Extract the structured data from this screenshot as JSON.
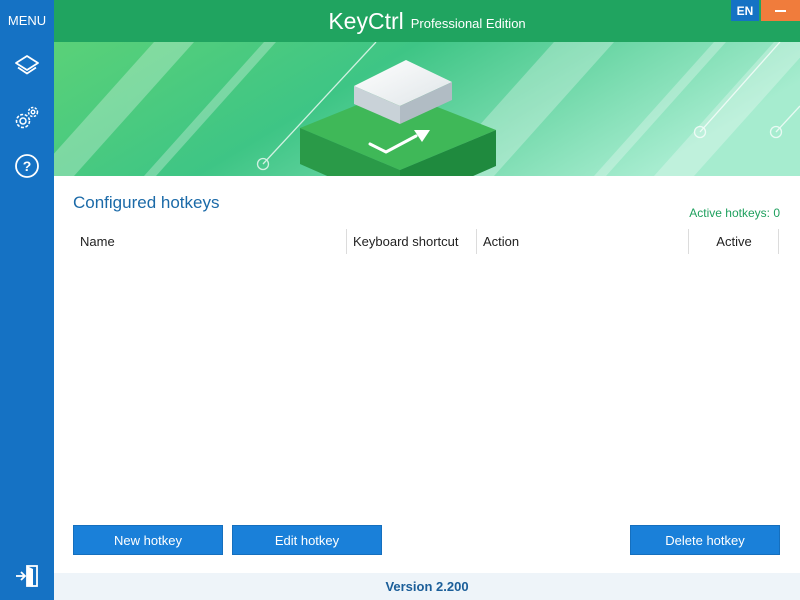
{
  "sidebar": {
    "menu_label": "MENU",
    "items": [
      {
        "icon": "layers-icon"
      },
      {
        "icon": "gears-icon"
      },
      {
        "icon": "help-icon"
      }
    ],
    "exit_icon": "exit-icon"
  },
  "header": {
    "app_name": "KeyCtrl",
    "edition": "Professional Edition",
    "language": "EN"
  },
  "main": {
    "section_title": "Configured hotkeys",
    "active_hotkeys": "Active hotkeys: 0",
    "columns": [
      "Name",
      "Keyboard shortcut",
      "Action",
      "Active"
    ],
    "rows": []
  },
  "buttons": {
    "new": "New hotkey",
    "edit": "Edit hotkey",
    "delete": "Delete hotkey"
  },
  "footer": {
    "version": "Version 2.200"
  },
  "colors": {
    "sidebar": "#1572c4",
    "header": "#20a460",
    "button": "#1a80d9",
    "minimize": "#f07c3c",
    "title_text": "#1b6aa8",
    "active_text": "#1fa05e"
  }
}
